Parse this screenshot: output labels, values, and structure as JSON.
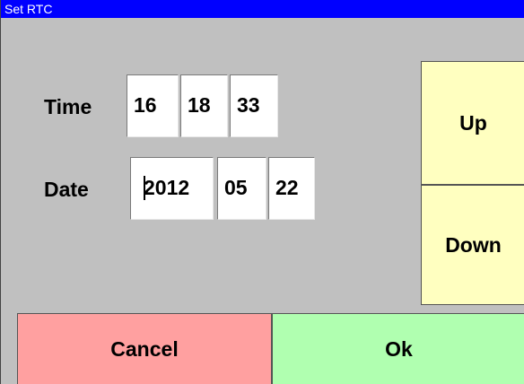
{
  "window": {
    "title": "Set RTC"
  },
  "time": {
    "label": "Time",
    "hour": "16",
    "minute": "18",
    "second": "33"
  },
  "date": {
    "label": "Date",
    "year": "2012",
    "month": "05",
    "day": "22"
  },
  "buttons": {
    "up": "Up",
    "down": "Down",
    "cancel": "Cancel",
    "ok": "Ok"
  },
  "colors": {
    "titlebar": "#0000ff",
    "background": "#c0c0c0",
    "adjust_buttons": "#ffffc0",
    "cancel": "#ffa0a0",
    "ok": "#b0ffb0"
  }
}
